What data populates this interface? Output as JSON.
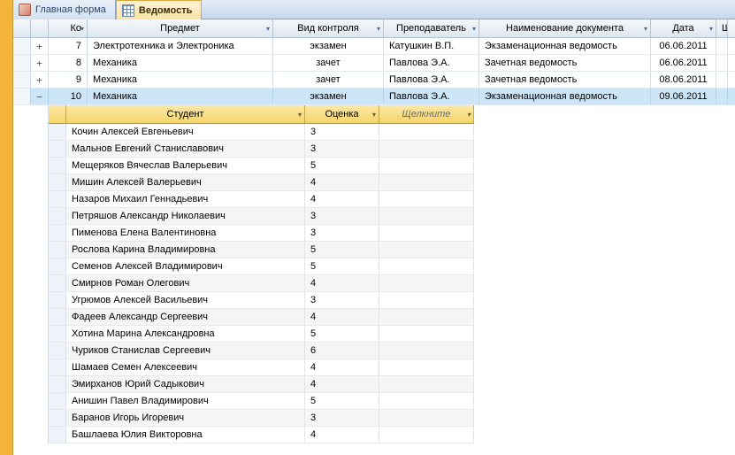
{
  "tabs": {
    "main_form": "Главная форма",
    "vedomost": "Ведомость"
  },
  "mainHeaders": {
    "ko": "Ко",
    "subject": "Предмет",
    "control": "Вид контроля",
    "teacher": "Преподаватель",
    "docname": "Наименование документа",
    "date": "Дата",
    "last": "Ш"
  },
  "mainRows": [
    {
      "exp": "+",
      "ko": "7",
      "subject": "Электротехника и Электроника",
      "control": "экзамен",
      "teacher": "Катушкин В.П.",
      "docname": "Экзаменационная ведомость",
      "date": "06.06.2011",
      "selected": false
    },
    {
      "exp": "+",
      "ko": "8",
      "subject": "Механика",
      "control": "зачет",
      "teacher": "Павлова Э.А.",
      "docname": "Зачетная ведомость",
      "date": "06.06.2011",
      "selected": false
    },
    {
      "exp": "+",
      "ko": "9",
      "subject": "Механика",
      "control": "зачет",
      "teacher": "Павлова Э.А.",
      "docname": "Зачетная ведомость",
      "date": "08.06.2011",
      "selected": false
    },
    {
      "exp": "−",
      "ko": "10",
      "subject": "Механика",
      "control": "экзамен",
      "teacher": "Павлова Э.А.",
      "docname": "Экзаменационная ведомость",
      "date": "09.06.2011",
      "selected": true
    }
  ],
  "subHeaders": {
    "student": "Студент",
    "grade": "Оценка",
    "click": "Щелкните"
  },
  "subRows": [
    {
      "student": "Кочин Алексей Евгеньевич",
      "grade": "3"
    },
    {
      "student": "Мальнов Евгений Станиславович",
      "grade": "3"
    },
    {
      "student": "Мещеряков Вячеслав Валерьевич",
      "grade": "5"
    },
    {
      "student": "Мишин Алексей Валерьевич",
      "grade": "4"
    },
    {
      "student": "Назаров Михаил Геннадьевич",
      "grade": "4"
    },
    {
      "student": "Петряшов Александр Николаевич",
      "grade": "3"
    },
    {
      "student": "Пименова Елена Валентиновна",
      "grade": "3"
    },
    {
      "student": "Рослова Карина Владимировна",
      "grade": "5"
    },
    {
      "student": "Семенов Алексей Владимирович",
      "grade": "5"
    },
    {
      "student": "Смирнов Роман Олегович",
      "grade": "4"
    },
    {
      "student": "Угрюмов Алексей Васильевич",
      "grade": "3"
    },
    {
      "student": "Фадеев Александр Сергеевич",
      "grade": "4"
    },
    {
      "student": "Хотина Марина Александровна",
      "grade": "5"
    },
    {
      "student": "Чуриков Станислав Сергеевич",
      "grade": "6"
    },
    {
      "student": "Шамаев Семен Алексеевич",
      "grade": "4"
    },
    {
      "student": "Эмирханов Юрий Садыкович",
      "grade": "4"
    },
    {
      "student": "Анишин Павел Владимирович",
      "grade": "5"
    },
    {
      "student": "Баранов Игорь Игоревич",
      "grade": "3"
    },
    {
      "student": "Башлаева Юлия Викторовна",
      "grade": "4"
    }
  ]
}
